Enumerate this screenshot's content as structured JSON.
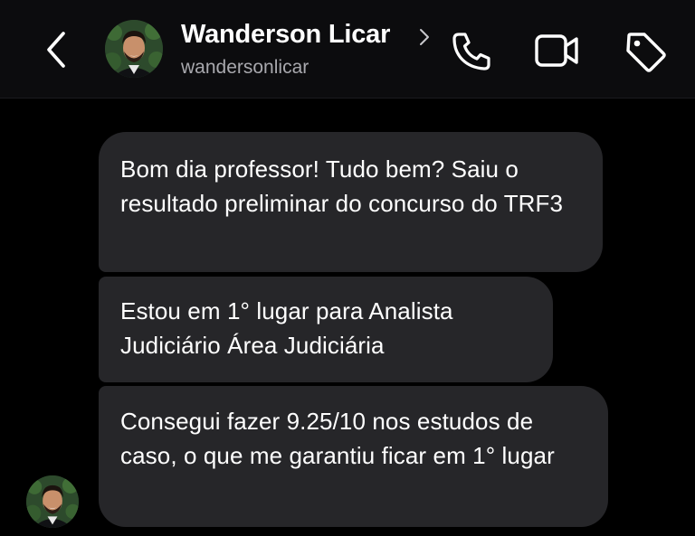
{
  "header": {
    "contact_name": "Wanderson Licar",
    "username": "wandersonlicar",
    "icons": {
      "back": "chevron-left-icon",
      "profile": "chevron-right-icon",
      "call": "phone-icon",
      "video": "video-camera-icon",
      "tag": "tag-icon"
    }
  },
  "messages": [
    {
      "text": "Bom dia professor! Tudo bem? Saiu o resultado preliminar do concurso do TRF3"
    },
    {
      "text": "Estou em 1°  lugar para Analista Judiciário Área Judiciária"
    },
    {
      "text": "Consegui fazer 9.25/10 nos estudos de caso, o que me garantiu ficar em 1° lugar"
    }
  ],
  "colors": {
    "background": "#000000",
    "header_background": "#0c0c0e",
    "bubble": "#262629",
    "text": "#ffffff",
    "secondary_text": "#a8a8ad"
  }
}
